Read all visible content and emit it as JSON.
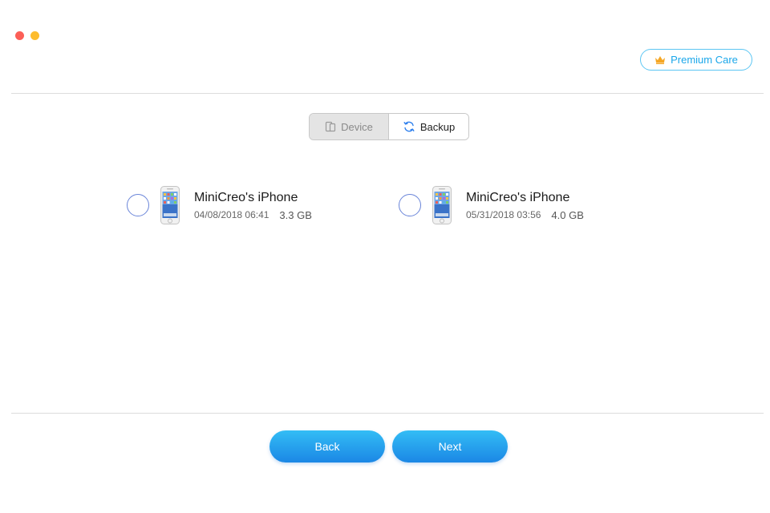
{
  "window": {
    "traffic_lights": {
      "close_color": "#fc5f57",
      "minimize_color": "#fdbc2e"
    }
  },
  "header": {
    "premium_label": "Premium Care",
    "premium_icon": "crown-icon",
    "premium_color": "#1aa7ea"
  },
  "segmented": {
    "device_label": "Device",
    "device_icon": "device-icon",
    "backup_label": "Backup",
    "backup_icon": "sync-icon",
    "active": "Backup"
  },
  "backups": [
    {
      "name": "MiniCreo's iPhone",
      "date": "04/08/2018 06:41",
      "size": "3.3 GB",
      "selected": false
    },
    {
      "name": "MiniCreo's iPhone",
      "date": "05/31/2018 03:56",
      "size": "4.0 GB",
      "selected": false
    }
  ],
  "footer": {
    "back_label": "Back",
    "next_label": "Next",
    "accent_color": "#1b9ff0"
  }
}
